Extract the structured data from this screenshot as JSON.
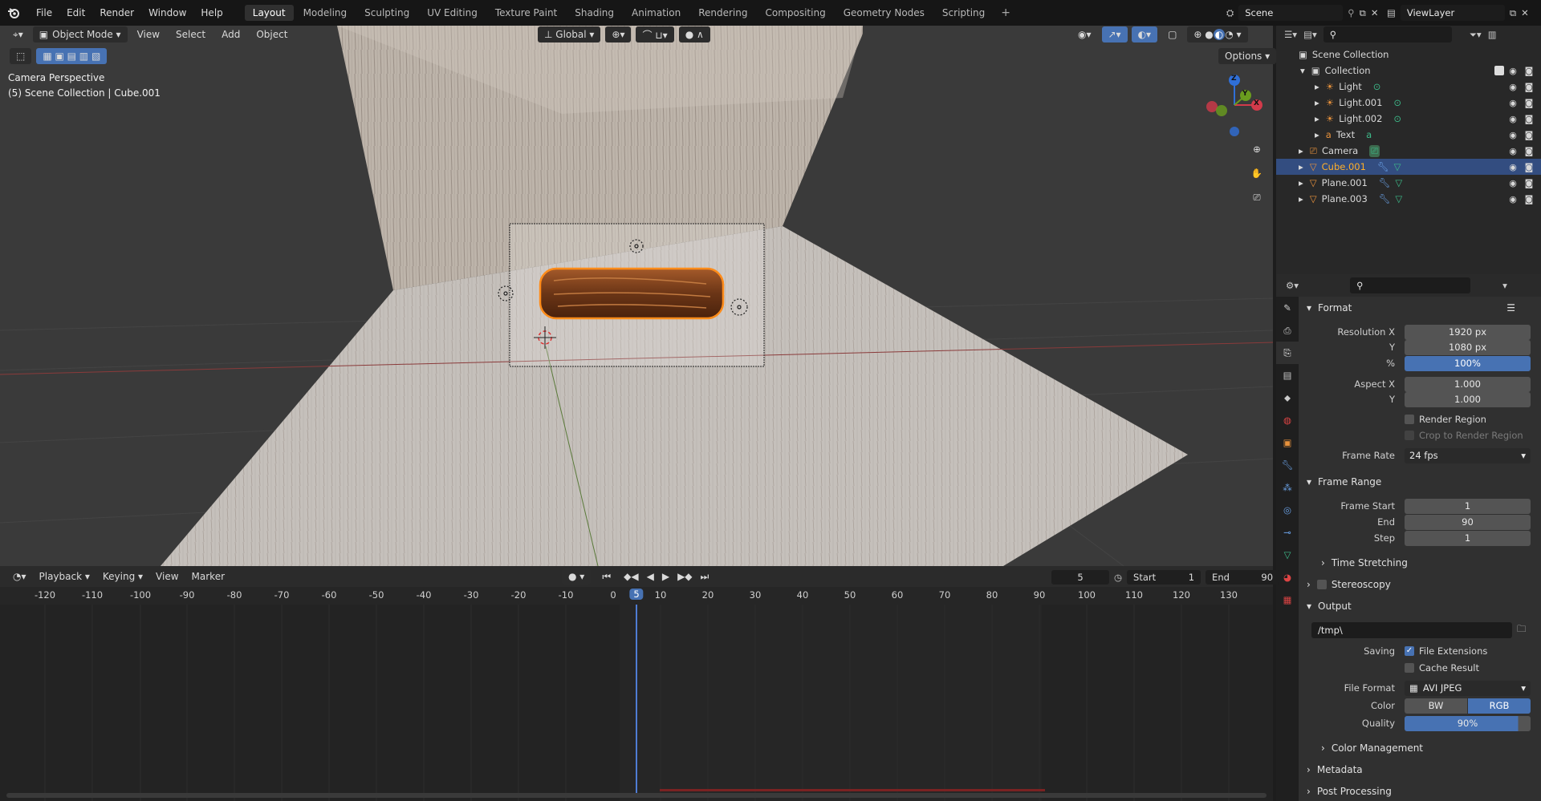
{
  "topbar": {
    "menus": [
      "File",
      "Edit",
      "Render",
      "Window",
      "Help"
    ],
    "workspaces": [
      "Layout",
      "Modeling",
      "Sculpting",
      "UV Editing",
      "Texture Paint",
      "Shading",
      "Animation",
      "Rendering",
      "Compositing",
      "Geometry Nodes",
      "Scripting"
    ],
    "active_workspace": "Layout",
    "add_workspace": "+",
    "scene": "Scene",
    "view_layer": "ViewLayer"
  },
  "viewport": {
    "mode": "Object Mode",
    "menus": [
      "View",
      "Select",
      "Add",
      "Object"
    ],
    "orientation": "Global",
    "options": "Options",
    "view_name": "Camera Perspective",
    "collection_info": "(5) Scene Collection | Cube.001",
    "gizmo_axes": {
      "z": "Z",
      "y": "Y",
      "x": "X"
    }
  },
  "timeline": {
    "menus": [
      "Playback",
      "Keying",
      "View",
      "Marker"
    ],
    "current_frame": "5",
    "start_label": "Start",
    "start": "1",
    "end_label": "End",
    "end": "90",
    "ticks": [
      "-120",
      "-110",
      "-100",
      "-90",
      "-80",
      "-70",
      "-60",
      "-50",
      "-40",
      "-30",
      "-20",
      "-10",
      "0",
      "5",
      "10",
      "20",
      "30",
      "40",
      "50",
      "60",
      "70",
      "80",
      "90",
      "100",
      "110",
      "120",
      "130"
    ]
  },
  "outliner": {
    "root": "Scene Collection",
    "collection": "Collection",
    "items": [
      {
        "name": "Light",
        "indent": 2
      },
      {
        "name": "Light.001",
        "indent": 2
      },
      {
        "name": "Light.002",
        "indent": 2
      },
      {
        "name": "Text",
        "indent": 2
      },
      {
        "name": "Camera",
        "indent": 1
      },
      {
        "name": "Cube.001",
        "indent": 1,
        "selected": true
      },
      {
        "name": "Plane.001",
        "indent": 1
      },
      {
        "name": "Plane.003",
        "indent": 1
      }
    ]
  },
  "properties": {
    "format": {
      "title": "Format",
      "res_x_label": "Resolution X",
      "res_x": "1920 px",
      "res_y_label": "Y",
      "res_y": "1080 px",
      "pct_label": "%",
      "pct": "100%",
      "aspect_x_label": "Aspect X",
      "aspect_x": "1.000",
      "aspect_y_label": "Y",
      "aspect_y": "1.000",
      "render_region": "Render Region",
      "crop_region": "Crop to Render Region",
      "frame_rate_label": "Frame Rate",
      "frame_rate": "24 fps"
    },
    "frame_range": {
      "title": "Frame Range",
      "start_label": "Frame Start",
      "start": "1",
      "end_label": "End",
      "end": "90",
      "step_label": "Step",
      "step": "1",
      "time_stretching": "Time Stretching"
    },
    "stereoscopy": "Stereoscopy",
    "output": {
      "title": "Output",
      "path": "/tmp\\",
      "saving_label": "Saving",
      "file_extensions": "File Extensions",
      "cache_result": "Cache Result",
      "file_format_label": "File Format",
      "file_format": "AVI JPEG",
      "color_label": "Color",
      "color_bw": "BW",
      "color_rgb": "RGB",
      "quality_label": "Quality",
      "quality": "90%",
      "color_management": "Color Management"
    },
    "metadata": "Metadata",
    "post_processing": "Post Processing"
  }
}
